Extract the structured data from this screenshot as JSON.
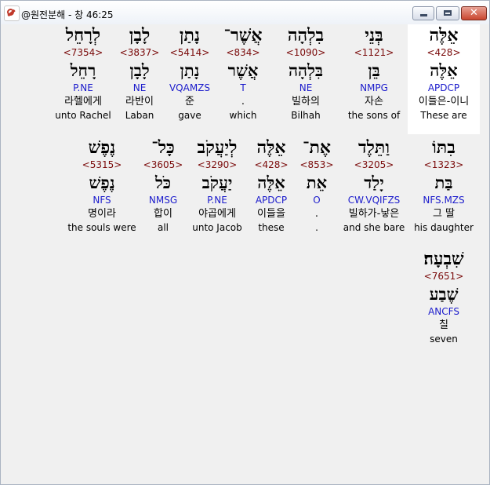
{
  "window": {
    "title": "@원전분해 - 창 46:25",
    "controls": {
      "minimize": "minimize",
      "maximize": "maximize",
      "close": "✕"
    }
  },
  "words": [
    {
      "heb": "אֵלֶּה",
      "strong": "<428>",
      "lemma": "אֵלֶּה",
      "parse": "APDCP",
      "korean": "이들은-이니",
      "english": "These are",
      "selected": true
    },
    {
      "heb": "בְּנֵי",
      "strong": "<1121>",
      "lemma": "בֵּן",
      "parse": "NMPG",
      "korean": "자손",
      "english": "the sons of"
    },
    {
      "heb": "בִלְהָה",
      "strong": "<1090>",
      "lemma": "בִּלְהָה",
      "parse": "NE",
      "korean": "빌하의",
      "english": "Bilhah"
    },
    {
      "heb": "אֲשֶׁר־",
      "strong": "<834>",
      "lemma": "אֲשֶׁר",
      "parse": "T",
      "korean": ".",
      "english": "which"
    },
    {
      "heb": "נָתַן",
      "strong": "<5414>",
      "lemma": "נָתַן",
      "parse": "VQAMZS",
      "korean": "준",
      "english": "gave"
    },
    {
      "heb": "לָבָן",
      "strong": "<3837>",
      "lemma": "לָבָן",
      "parse": "NE",
      "korean": "라반이",
      "english": "Laban"
    },
    {
      "heb": "לְרָחֵל",
      "strong": "<7354>",
      "lemma": "רָחֵל",
      "parse": "P.NE",
      "korean": "라헬에게",
      "english": "unto Rachel"
    },
    {
      "heb": "בִתּוֹ",
      "strong": "<1323>",
      "lemma": "בַּת",
      "parse": "NFS.MZS",
      "korean": "그 딸",
      "english": "his daughter"
    },
    {
      "heb": "וַתֵּלֶד",
      "strong": "<3205>",
      "lemma": "יָלַד",
      "parse": "CW.VQIFZS",
      "korean": "빌하가-낳은",
      "english": "and she bare"
    },
    {
      "heb": "אֶת־",
      "strong": "<853>",
      "lemma": "אֵת",
      "parse": "O",
      "korean": ".",
      "english": "."
    },
    {
      "heb": "אֵלֶּה",
      "strong": "<428>",
      "lemma": "אֵלֶּה",
      "parse": "APDCP",
      "korean": "이들을",
      "english": "these"
    },
    {
      "heb": "לְיַעֲקֹב",
      "strong": "<3290>",
      "lemma": "יַעֲקֹב",
      "parse": "P.NE",
      "korean": "야곱에게",
      "english": "unto Jacob"
    },
    {
      "heb": "כָּל־",
      "strong": "<3605>",
      "lemma": "כֹּל",
      "parse": "NMSG",
      "korean": "합이",
      "english": "all"
    },
    {
      "heb": "נֶפֶשׁ",
      "strong": "<5315>",
      "lemma": "נֶפֶשׁ",
      "parse": "NFS",
      "korean": "명이라",
      "english": "the souls were"
    },
    {
      "heb": "שִׁבְעָה׃",
      "strong": "<7651>",
      "lemma": "שֶׁבַע",
      "parse": "ANCFS",
      "korean": "칠",
      "english": "seven"
    }
  ]
}
